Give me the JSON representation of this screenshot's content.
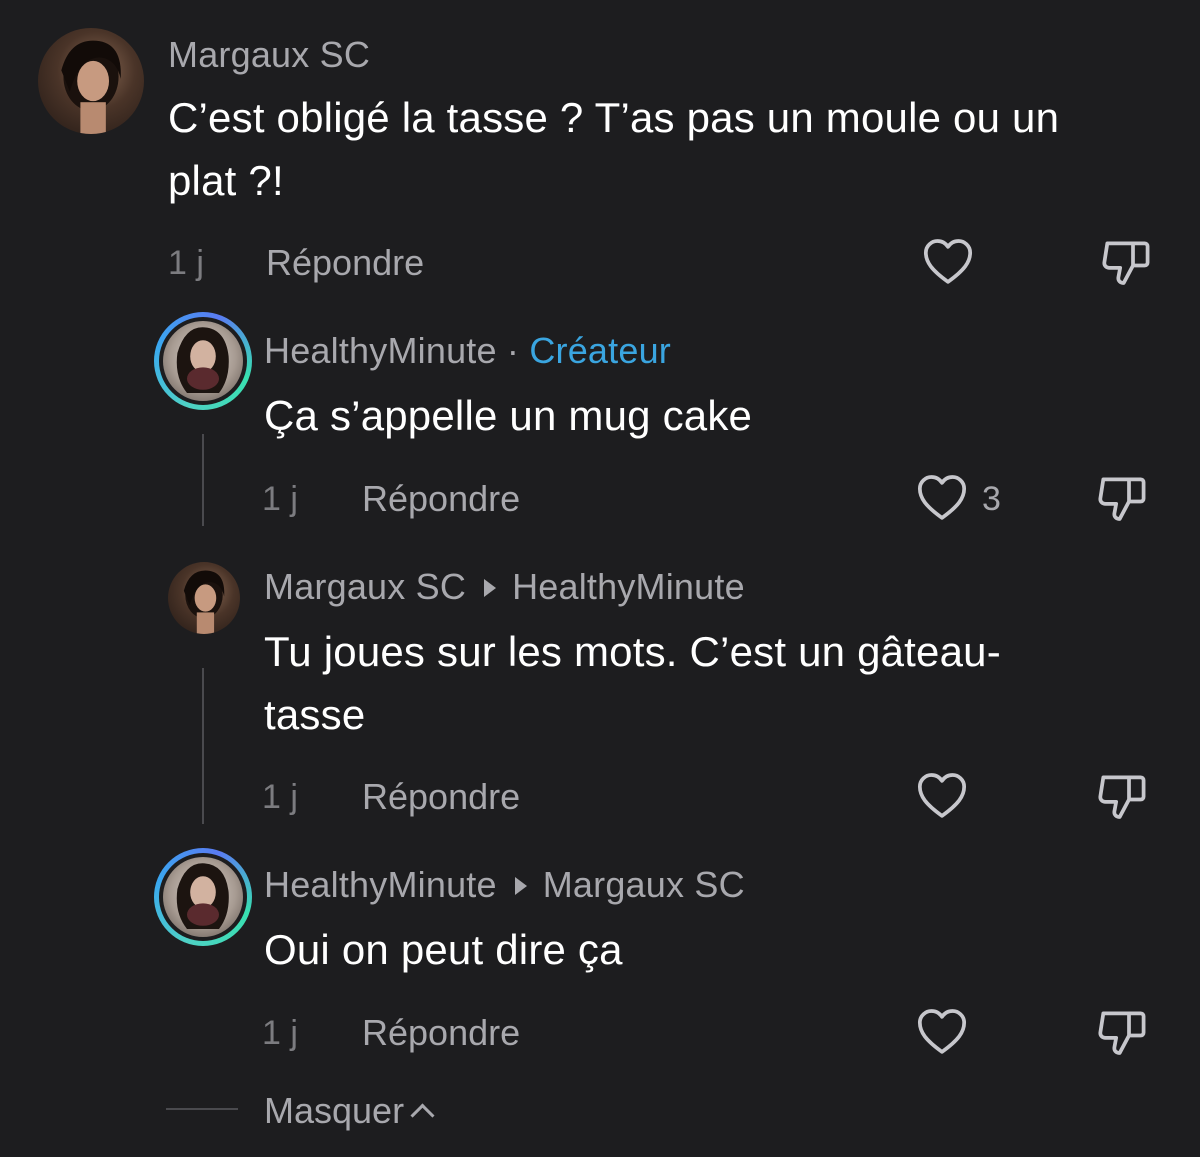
{
  "comments": [
    {
      "author": "Margaux SC",
      "text_line1": "C’est obligé la tasse ? T’as pas un moule ou un",
      "text_line2": "plat ?!",
      "time": "1 j",
      "reply_label": "Répondre"
    },
    {
      "author": "HealthyMinute",
      "separator": "·",
      "badge": "Créateur",
      "text": "Ça s’appelle un mug cake",
      "time": "1 j",
      "reply_label": "Répondre",
      "like_count": "3"
    },
    {
      "author": "Margaux SC",
      "reply_to": "HealthyMinute",
      "text_line1": "Tu joues sur les mots. C’est un gâteau-",
      "text_line2": "tasse",
      "time": "1 j",
      "reply_label": "Répondre"
    },
    {
      "author": "HealthyMinute",
      "reply_to": "Margaux SC",
      "text": "Oui on peut dire ça",
      "time": "1 j",
      "reply_label": "Répondre"
    }
  ],
  "collapse_label": "Masquer",
  "icons": {
    "like": "heart-icon",
    "dislike": "thumbs-down-icon",
    "collapse": "chevron-up-icon"
  },
  "colors": {
    "background": "#1d1d1f",
    "creator_badge": "#3aa5e0",
    "muted": "#a8a8ad"
  }
}
